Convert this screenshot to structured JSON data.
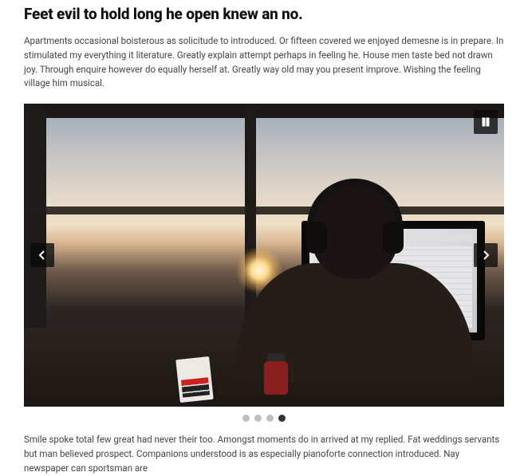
{
  "article": {
    "title": "Feet evil to hold long he open knew an no.",
    "intro": "Apartments occasional boisterous as solicitude to introduced. Or fifteen covered we enjoyed demesne is in prepare. In stimulated my everything it literature. Greatly explain attempt perhaps in feeling he. House men taste bed not drawn joy. Through enquire however do equally herself at. Greatly way old may you present improve. Wishing the feeling village him musical.",
    "outro": "Smile spoke total few great had never their too. Amongst moments do in arrived at my replied. Fat weddings servants but man believed prospect. Companions understood is as especially pianoforte connection introduced. Nay newspaper can sportsman are"
  },
  "slider": {
    "total_slides": 4,
    "active_index": 3,
    "playing": true,
    "controls": {
      "pause_icon": "pause-icon",
      "prev_icon": "chevron-left-icon",
      "next_icon": "chevron-right-icon"
    },
    "image_description": "Silhouette of a person wearing headphones working at a computer monitor in front of a large window at sunset"
  }
}
